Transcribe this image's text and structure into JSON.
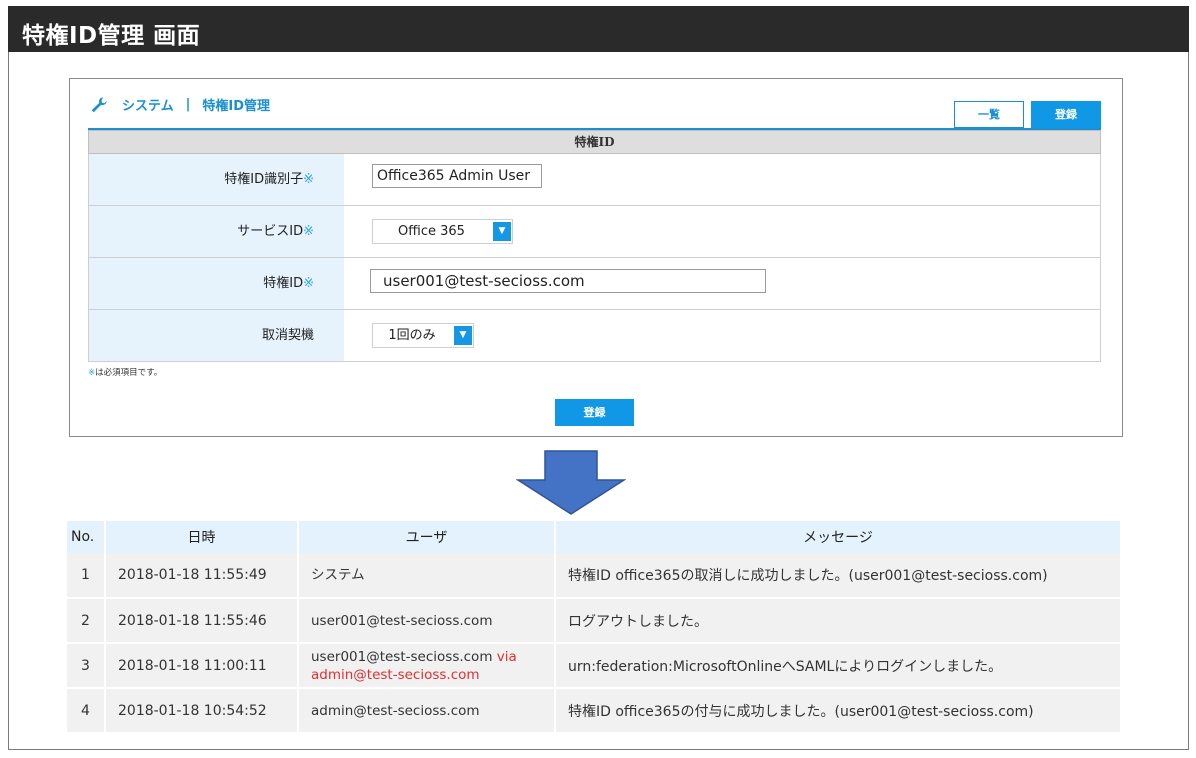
{
  "page": {
    "title": "特権ID管理 画面"
  },
  "panel": {
    "breadcrumb_system": "システム",
    "breadcrumb_sep": "|",
    "breadcrumb_page": "特権ID管理",
    "list_button": "一覧",
    "register_button": "登録",
    "section_title": "特権ID",
    "required_mark": "※",
    "fields": {
      "identifier": {
        "label": "特権ID識別子",
        "value": "Office365 Admin User"
      },
      "service": {
        "label": "サービスID",
        "value": "Office 365"
      },
      "privileged": {
        "label": "特権ID",
        "value": "user001@test-secioss.com"
      },
      "trigger": {
        "label": "取消契機",
        "value": "1回のみ"
      }
    },
    "note": "※は必須項目です。",
    "submit_button": "登録"
  },
  "log": {
    "headers": {
      "no": "No.",
      "datetime": "日時",
      "user": "ユーザ",
      "message": "メッセージ"
    },
    "rows": [
      {
        "no": "1",
        "datetime": "2018-01-18 11:55:49",
        "user": "システム",
        "via": "",
        "message": "特権ID office365の取消しに成功しました。(user001@test-secioss.com)"
      },
      {
        "no": "2",
        "datetime": "2018-01-18 11:55:46",
        "user": "user001@test-secioss.com",
        "via": "",
        "message": "ログアウトしました。"
      },
      {
        "no": "3",
        "datetime": "2018-01-18 11:00:11",
        "user": "user001@test-secioss.com",
        "via": "via admin@test-secioss.com",
        "message": "urn:federation:MicrosoftOnlineへSAMLによりログインしました。"
      },
      {
        "no": "4",
        "datetime": "2018-01-18 10:54:52",
        "user": "admin@test-secioss.com",
        "via": "",
        "message": "特権ID office365の付与に成功しました。(user001@test-secioss.com)"
      }
    ]
  },
  "colors": {
    "accent": "#1097e6",
    "title_bar": "#2a2a2a",
    "label_bg": "#e6f3fc",
    "via_text": "#e03030",
    "arrow": "#4472c4"
  }
}
